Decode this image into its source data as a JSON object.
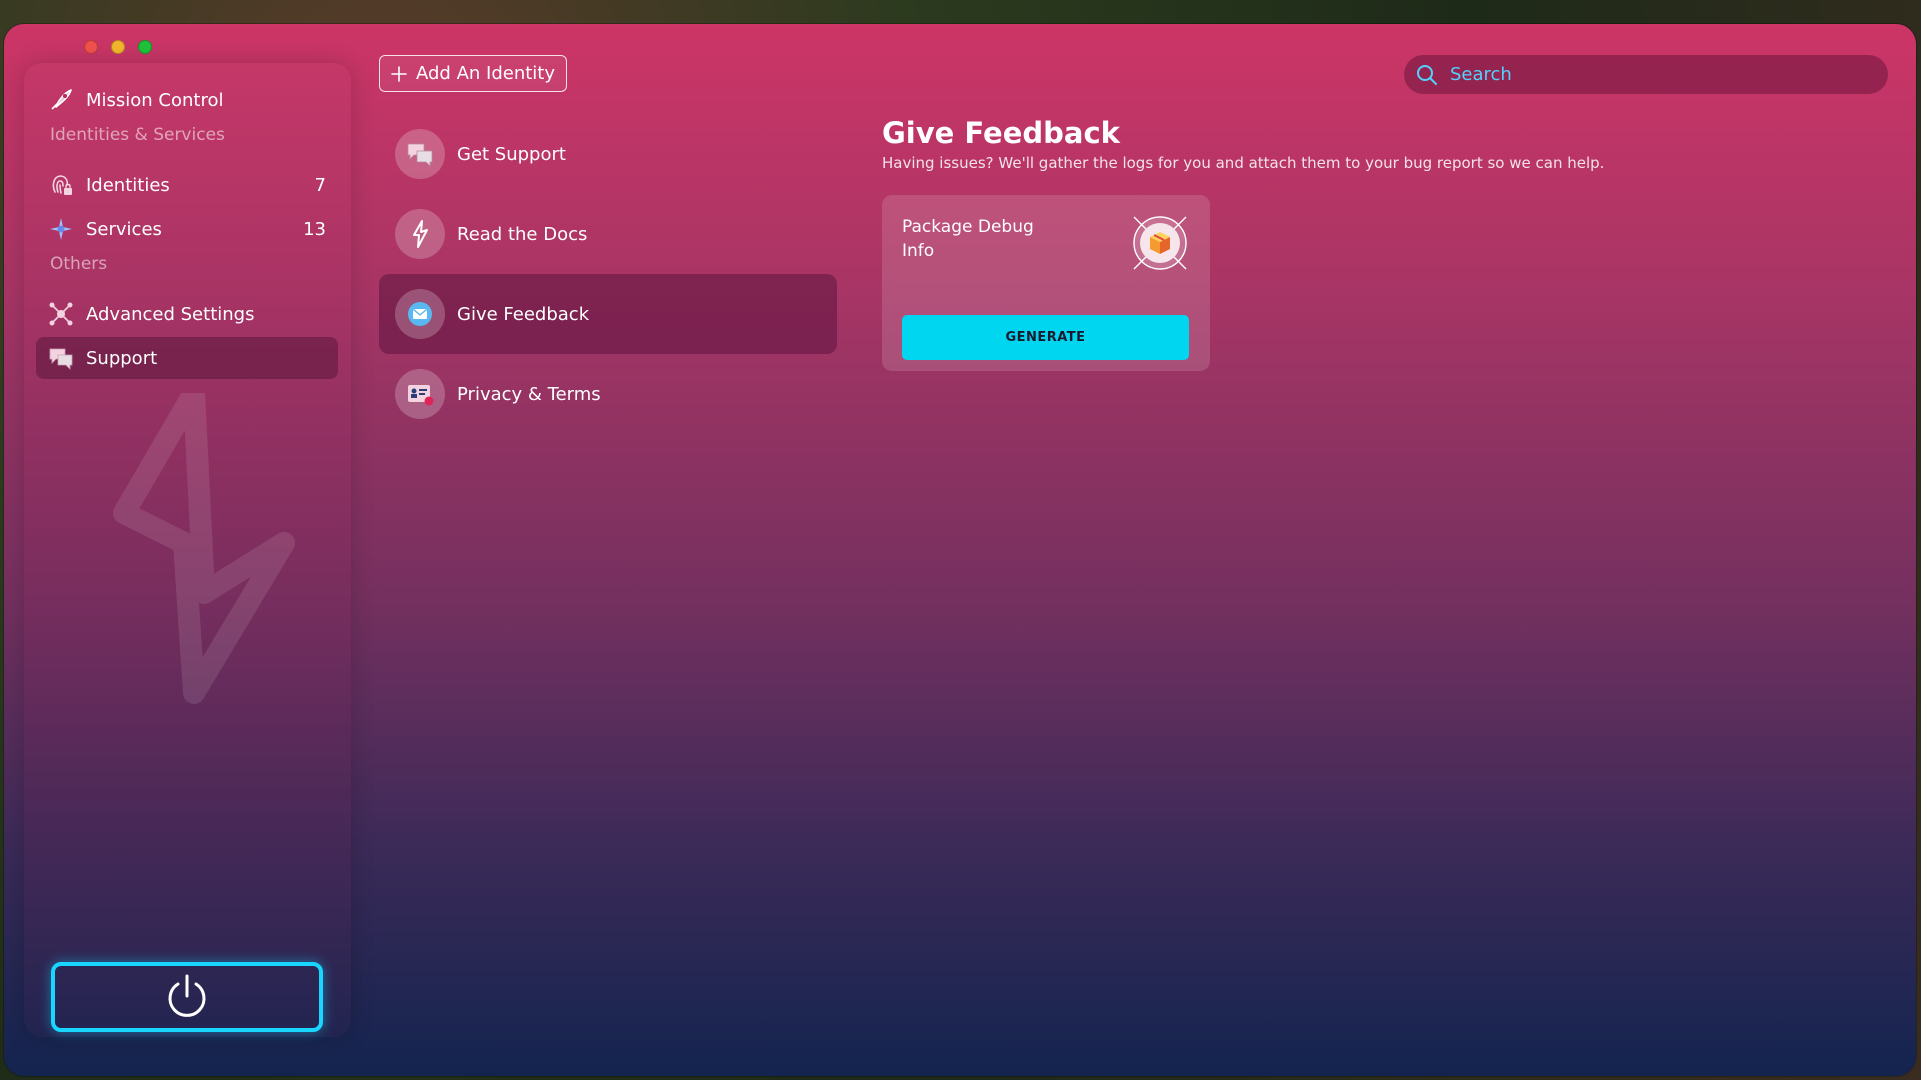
{
  "window": {
    "controls": [
      "close",
      "minimize",
      "maximize"
    ]
  },
  "sidebar": {
    "mission_control": "Mission Control",
    "section_identities": "Identities & Services",
    "identities": {
      "label": "Identities",
      "count": "7"
    },
    "services": {
      "label": "Services",
      "count": "13"
    },
    "section_others": "Others",
    "advanced_settings": "Advanced Settings",
    "support": "Support",
    "power_icon": "power-icon"
  },
  "header": {
    "add_identity": "Add An Identity",
    "search_placeholder": "Search"
  },
  "support_menu": {
    "items": [
      {
        "label": "Get Support",
        "icon": "chat-bubbles-icon"
      },
      {
        "label": "Read the Docs",
        "icon": "lightning-icon"
      },
      {
        "label": "Give Feedback",
        "icon": "mail-icon"
      },
      {
        "label": "Privacy & Terms",
        "icon": "id-card-icon"
      }
    ],
    "active": "Give Feedback"
  },
  "feedback": {
    "title": "Give Feedback",
    "description": "Having issues? We'll gather the logs for you and attach them to your bug report so we can help.",
    "card": {
      "title": "Package Debug Info",
      "icon": "package-icon",
      "button": "GENERATE"
    }
  },
  "colors": {
    "accent": "#00d6f0",
    "search_text": "#52d2ff",
    "power_border": "#18d6ff"
  }
}
